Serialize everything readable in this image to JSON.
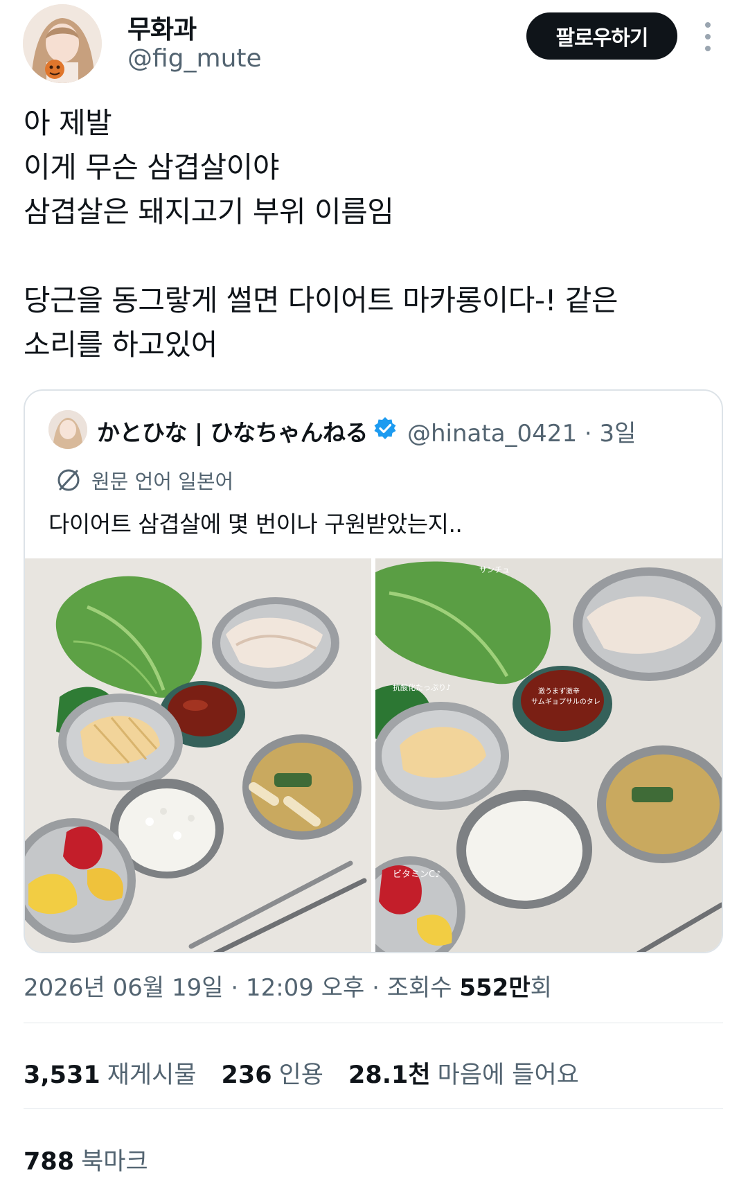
{
  "author": {
    "display_name": "무화과",
    "handle": "@fig_mute"
  },
  "follow_label": "팔로우하기",
  "tweet": {
    "lines": [
      "아 제발",
      "이게 무슨 삼겹살이야",
      "삼겹살은 돼지고기 부위 이름임",
      "",
      "당근을 동그랗게 썰면 다이어트 마카롱이다-! 같은",
      "소리를 하고있어"
    ]
  },
  "quoted": {
    "display_name": "かとひな | ひなちゃんねる",
    "handle_date": "@hinata_0421 · 3일",
    "translation_label": "원문 언어 일본어",
    "text": "다이어트 삼겹살에 몇 번이나 구원받았는지..",
    "images": [
      {
        "overlay_texts": []
      },
      {
        "overlay_texts": [
          "サンチュ",
          "抗酸化たっぷり♪",
          "激うまず激辛",
          "サムギョプサルのタレ",
          "ビタミンC♪"
        ]
      }
    ]
  },
  "meta": {
    "date_time": "2026년 06월 19일 · 12:09 오후 · 조회수 ",
    "views": "552만",
    "views_suffix": "회"
  },
  "stats": {
    "reposts": {
      "count": "3,531",
      "label": "재게시물"
    },
    "quotes": {
      "count": "236",
      "label": "인용"
    },
    "likes": {
      "count": "28.1천",
      "label": "마음에 들어요"
    },
    "bookmarks": {
      "count": "788",
      "label": "북마크"
    }
  },
  "colors": {
    "text_primary": "#0f1419",
    "text_secondary": "#536471",
    "follow_bg": "#0f1419",
    "verified": "#1d9bf0",
    "border": "#dde3e8"
  },
  "icons": [
    "more-vertical-icon",
    "verified-badge-icon",
    "globe-translate-icon"
  ]
}
